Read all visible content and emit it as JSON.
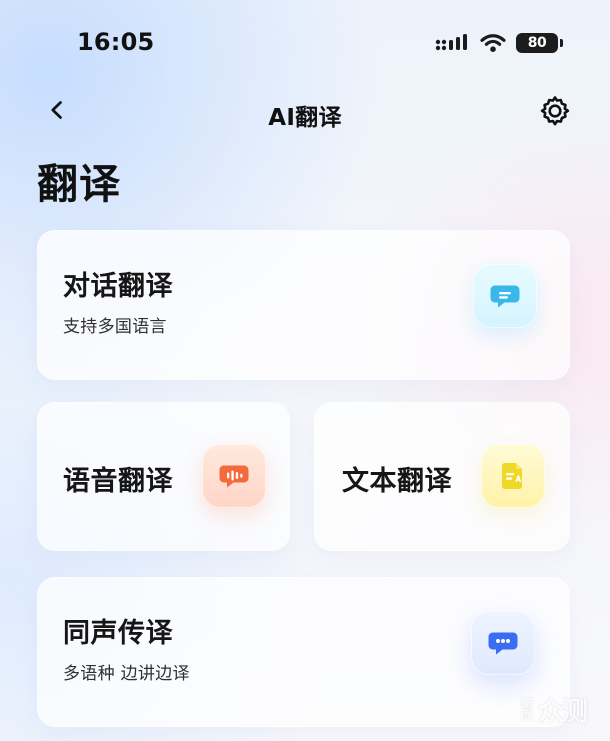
{
  "status_bar": {
    "time": "16:05",
    "battery": "80",
    "icons": [
      "signal-icon",
      "wifi-icon",
      "battery-icon"
    ]
  },
  "nav": {
    "title": "AI翻译",
    "back_icon": "back-icon",
    "settings_icon": "gear-icon"
  },
  "page": {
    "title": "翻译"
  },
  "cards": {
    "dialog": {
      "title": "对话翻译",
      "subtitle": "支持多国语言",
      "icon": "chat-bubble-icon",
      "accent": "#39b7eb"
    },
    "voice": {
      "title": "语音翻译",
      "icon": "voice-bubble-icon",
      "accent": "#f36b3d"
    },
    "text": {
      "title": "文本翻译",
      "icon": "text-document-icon",
      "accent": "#efd928"
    },
    "sync": {
      "title": "同声传译",
      "subtitle": "多语种 边讲边译",
      "icon": "message-dots-icon",
      "accent": "#3b6df3"
    }
  },
  "watermark": {
    "left_text": "新浪",
    "right_text": "众测"
  }
}
